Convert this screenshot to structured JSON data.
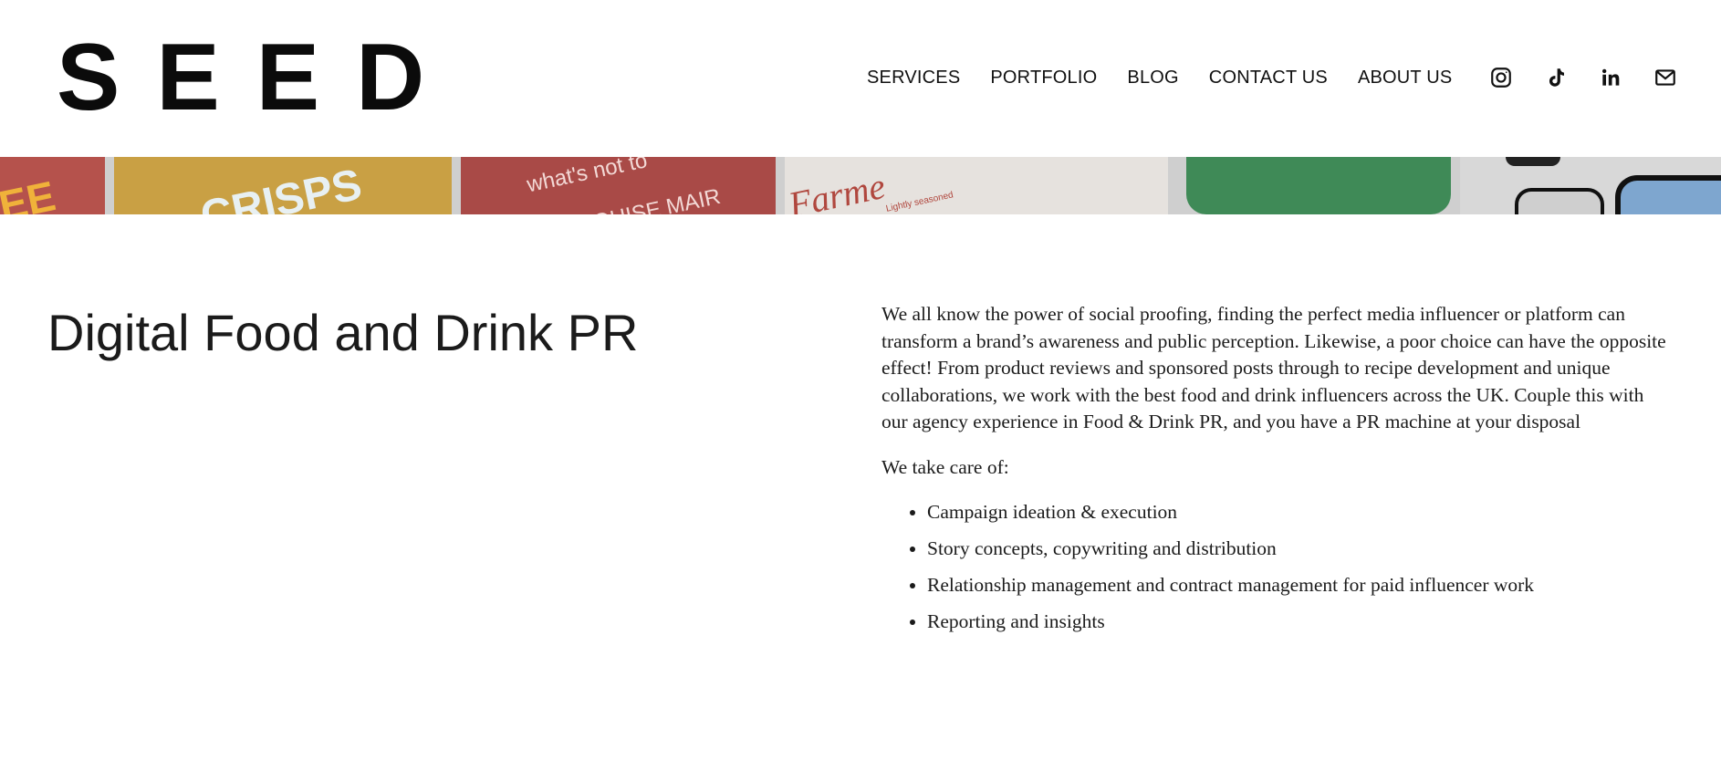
{
  "header": {
    "logo": "SEED",
    "nav": [
      "SERVICES",
      "PORTFOLIO",
      "BLOG",
      "CONTACT US",
      "ABOUT US"
    ],
    "socials": [
      "instagram-icon",
      "tiktok-icon",
      "linkedin-icon",
      "email-icon"
    ]
  },
  "banner": {
    "tiles": [
      {
        "text": "EE",
        "bg": "#b5524c",
        "color": "#f0b23a"
      },
      {
        "text": "CRISPS",
        "bg": "#c9a044",
        "color": "#e8f0f2"
      },
      {
        "text": "what's not to",
        "bg": "#a94a47",
        "color": "#f3d9d6"
      },
      {
        "text": "LOUISE MAIR",
        "bg": "#a94a47",
        "color": "#f3d9d6"
      },
      {
        "text": "Farme",
        "bg": "#e6e2de",
        "color": "#b0473e"
      },
      {
        "text": "Lightly seasoned",
        "bg": "#d9d9d9",
        "color": "#333"
      },
      {
        "text": "",
        "bg": "#3f8a57",
        "color": "#fff"
      }
    ]
  },
  "main": {
    "heading": "Digital Food and Drink PR",
    "intro": "We all know the power of social proofing, finding the perfect media influencer or platform can transform a brand’s awareness and public perception. Likewise, a poor choice can have the opposite effect! From product reviews and sponsored posts through to recipe development and unique collaborations, we work with the best food and drink influencers across the UK. Couple this with our agency experience in Food & Drink PR, and you have a PR machine at your disposal",
    "list_title": "We take care of:",
    "items": [
      "Campaign ideation & execution",
      "Story concepts, copywriting and distribution",
      "Relationship management and contract management for paid influencer work",
      "Reporting and insights"
    ]
  }
}
